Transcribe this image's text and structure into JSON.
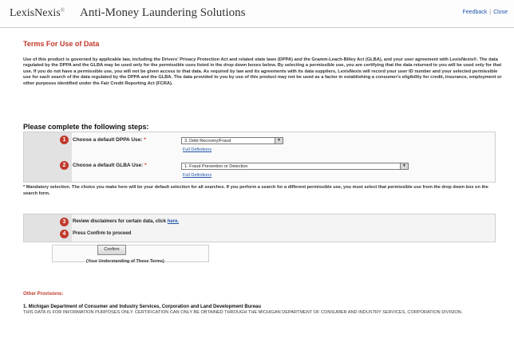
{
  "header": {
    "brand": "LexisNexis",
    "brand_mark": "®",
    "product": "Anti-Money Laundering Solutions",
    "feedback_link": "Feedback",
    "separator": "|",
    "close_link": "Close"
  },
  "terms": {
    "title": "Terms For Use of Data",
    "intro": "Use of this product is governed by applicable law, including the Drivers' Privacy Protection Act and related state laws (DPPA) and the Gramm-Leach-Bliley Act (GLBA), and your user agreement with LexisNexis®. The data regulated by the DPPA and the GLBA may be used only for the permissible uses listed in the drop down boxes below. By selecting a permissible use, you are certifying that the data returned to you will be used only for that use. If you do not have a permissible use, you will not be given access to that data. As required by law and its agreements with its data suppliers, LexisNexis will record your user ID number and your selected permissible use for each search of the data regulated by the DPPA and the GLBA. The data provided to you by use of this product may not be used as a factor in establishing a consumer's eligibility for credit, insurance, employment or other purposes identified under the Fair Credit Reporting Act (FCRA)."
  },
  "steps": {
    "heading": "Please complete the following steps:",
    "step1": {
      "number": "1",
      "label": "Choose a default DPPA Use:",
      "required_mark": "*",
      "selected": "3. Debt Recovery/Fraud",
      "full_definitions": "Full Definitions"
    },
    "step2": {
      "number": "2",
      "label": "Choose a default GLBA Use:",
      "required_mark": "*",
      "selected": "1. Fraud Prevention or Detection",
      "full_definitions": "Full Definitions"
    },
    "mandatory_note": "* Mandatory selection. The choice you make here will be your default selection for all searches. If you perform a search for a different permissible use, you must select that permissible use from the drop down box on the search form.",
    "step3": {
      "number": "3",
      "text": "Review disclaimers for certain data, click",
      "link": "here."
    },
    "step4": {
      "number": "4",
      "text": "Press Confirm to proceed"
    },
    "confirm_button": "Confirm",
    "understanding": "(Your Understanding of These Terms)"
  },
  "other": {
    "heading": "Other Provisions:",
    "michigan_title": "1. Michigan Department of Consumer and Industry Services, Corporation and Land Development Bureau",
    "michigan_body": "THIS DATA IS FOR INFORMATION PURPOSES ONLY. CERTIFICATION CAN ONLY BE OBTAINED THROUGH THE MICHIGAN DEPARTMENT OF CONSUMER AND INDUSTRY SERVICES, CORPORATION DIVISION."
  },
  "colors": {
    "accent_red": "#c0392b",
    "link_blue": "#2255aa"
  }
}
